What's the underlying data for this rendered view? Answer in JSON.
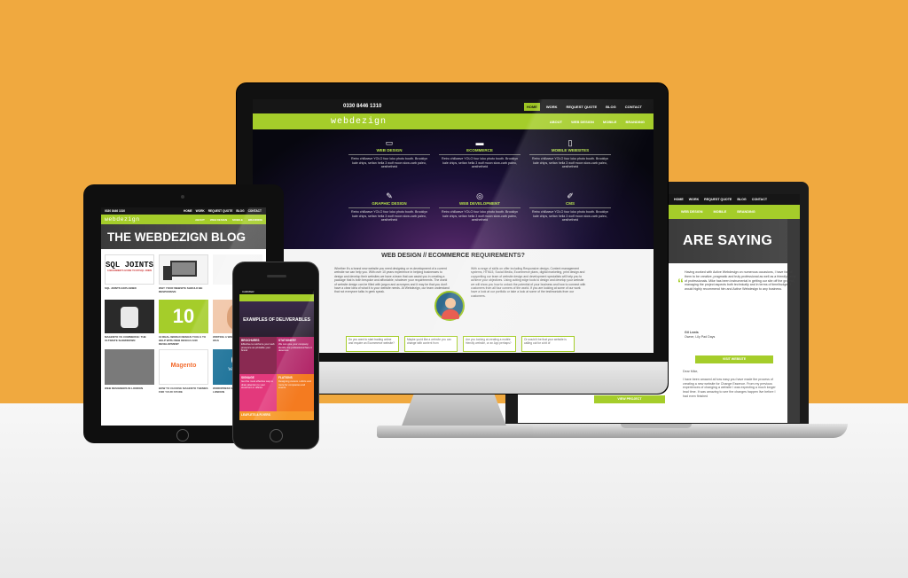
{
  "imac": {
    "phone": "0330 8446 1310",
    "top_nav": [
      "HOME",
      "WORK",
      "REQUEST QUOTE",
      "BLOG",
      "CONTACT"
    ],
    "logo": "webdezign",
    "main_menu": [
      "ABOUT",
      "WEB DESIGN",
      "MOBILE",
      "BRANDING"
    ],
    "features": [
      {
        "title": "WEB DESIGN",
        "text": "Retro chillwave YOLO four loko photo booth. Brooklyn kale chips, seitan hella 3 wolf moon slow-carb paleo, aesthetheid"
      },
      {
        "title": "ECOMMERCE",
        "text": "Retro chillwave YOLO four loko photo booth. Brooklyn kale chips, seitan hella 3 wolf moon slow-carb paleo, aesthetheid"
      },
      {
        "title": "MOBILE WEBSITES",
        "text": "Retro chillwave YOLO four loko photo booth. Brooklyn kale chips, seitan hella 3 wolf moon slow-carb paleo, aesthetheid"
      },
      {
        "title": "GRAPHIC DESIGN",
        "text": "Retro chillwave YOLO four loko photo booth. Brooklyn kale chips, seitan hella 3 wolf moon slow-carb paleo, aesthetheid"
      },
      {
        "title": "WEB DEVELOPMENT",
        "text": "Retro chillwave YOLO four loko photo booth. Brooklyn kale chips, seitan hella 3 wolf moon slow-carb paleo, aesthetheid"
      },
      {
        "title": "CMS",
        "text": "Retro chillwave YOLO four loko photo booth. Brooklyn kale chips, seitan hella 3 wolf moon slow-carb paleo, aesthetheid"
      }
    ],
    "section_heading": "WEB DESIGN // ECOMMERCE REQUIREMENTS?",
    "left_text": "Whether it's a brand new website you need designing or re-development of a current website we can help you. With over 10 years experience in helping businesses to design and develop their websites we have a team that can assist you in creating a package that is both bespoke and affordable, whatever your requirements. The world of website design can be filled with jargon and acronyms and it may be that you don't have a clear idea of what it is your website needs. At Webdezign, our team understand that not everyone talks in geek speak.",
    "right_text": "With a range of skills on offer including Responsive design, Content management systems, HTML5, Social Media, Ecommerce plans, digital marketing, print design and copywriting our team of website design and development specialists will help you to achieve your objectives. Using cutting edge tools to design and develop your website we will show you how to unlock the potential of your business and how to connect with customers from all four corners of the world. If you are looking at some of our work have a look at our portfolio or take a look at some of the testimonials from our customers.",
    "boxes": [
      "Do you want to start trading online and require an Ecommerce website?",
      "Maybe you'd like a website you can change with content from",
      "Are you looking at creating a mobile friendly website, or an App perhaps?",
      "Or would it be that your website is calling out for a bit of"
    ]
  },
  "laptop": {
    "top_nav": [
      "HOME",
      "WORK",
      "REQUEST QUOTE",
      "BLOG",
      "CONTACT"
    ],
    "menu": [
      "WEB DESIGN",
      "MOBILE",
      "BRANDING"
    ],
    "title": "ARE SAYING",
    "quote_text": "Having worked with Active Webdesign on numerous occasions, I have found them to be creative, pragmatic and truly professional as well as a friendly group of professionals. Mike has been instrumental in getting our site off the ground, managing the project aspects both technically and in terms of time/budget. I would highly recommend him and Active Webdesign to any business.",
    "author": "Gil Lewis",
    "author_role": "Owner, Lily Pad Days",
    "button": "VISIT WEBSITE",
    "second_quote_greeting": "Dear Mike,",
    "second_quote": "I have been amazed at how easy you have made the process of creating a new website for Change Essence. From my previous experiences of changing a website I was expecting a much longer lead time. It was amazing to see the changes happen live before I had even finished",
    "view_project": "VIEW PROJECT"
  },
  "ipad": {
    "phone": "0330 8446 1310",
    "top_nav": [
      "HOME",
      "WORK",
      "REQUEST QUOTE",
      "BLOG",
      "CONTACT"
    ],
    "logo": "webdezign",
    "menu": [
      "ABOUT",
      "WEB DESIGN",
      "MOBILE",
      "BRANDING"
    ],
    "title": "THE WEBDEZIGN BLOG",
    "posts": [
      {
        "image_text": "SQL JOINTS",
        "image_subtext": "A BEGINNER'S GUIDE TO MYSQL JOINS",
        "caption": "SQL JOINTS EXPLAINED"
      },
      {
        "image_text": "",
        "image_subtext": "",
        "caption": "WHY YOUR WEBSITE SHOULD BE RESPONSIVE"
      },
      {
        "image_text": "",
        "image_subtext": "",
        "caption": ""
      },
      {
        "image_text": "",
        "image_subtext": "",
        "caption": "MAGENTO VS COMMERCE: THE ULTIMATE SHOWDOWN"
      },
      {
        "image_text": "10",
        "image_subtext": "",
        "caption": "10 REAL-WORLD DESIGN TOOLS TO HELP WITH WEB DESIGN AND DEVELOPMENT"
      },
      {
        "image_text": "",
        "image_subtext": "",
        "caption": "WRITING A WEB COPY - ALWAYS IT WAS"
      },
      {
        "image_text": "",
        "image_subtext": "",
        "caption": "WEB DESIGNERS IN LONDON"
      },
      {
        "image_text": "Magento",
        "image_subtext": "",
        "caption": "HOW TO CHOOSE MAGENTO THEMES FOR YOUR STORE"
      },
      {
        "image_text": "WordPress",
        "image_subtext": "",
        "caption": "WORDPRESS WEB DESIGN IN LONDON"
      }
    ]
  },
  "iphone": {
    "carrier": "CARRIER",
    "title": "EXAMPLES OF DELIVERABLES",
    "cells": [
      {
        "title": "BROCHURES",
        "text": "Effective to reinforce your web presence as printable your brand",
        "color": "#8a2a52"
      },
      {
        "title": "STATIONERY",
        "text": "We can give your company identity the professional face it deserves",
        "color": "#b3296a"
      },
      {
        "title": "SIGNAGE",
        "text": "Get the most effective way to draw attention to your storefront or offices",
        "color": "#e3397c"
      },
      {
        "title": "FLATIONS",
        "text": "Designing custom t-shirts and more for companies and events",
        "color": "#f47b20"
      }
    ],
    "footer_cell": "LEAFLETS & FLYERS"
  },
  "colors": {
    "background": "#f0a93f",
    "accent_green": "#a5cd2a"
  }
}
